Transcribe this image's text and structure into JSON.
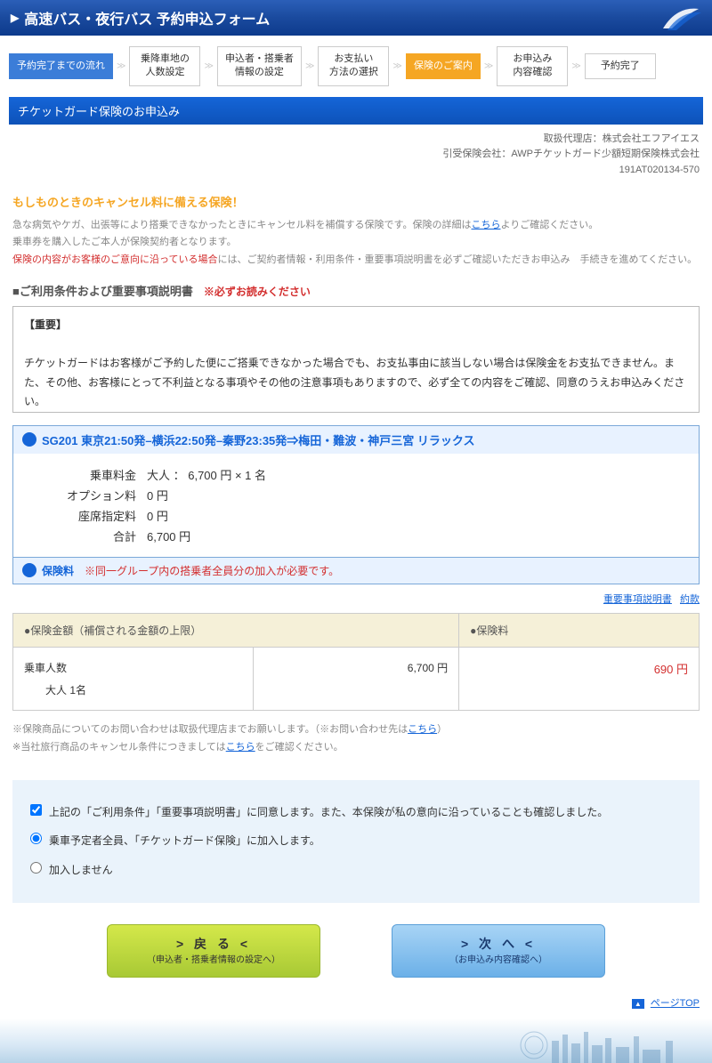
{
  "header": {
    "title": "高速バス・夜行バス 予約申込フォーム"
  },
  "steps": [
    {
      "label": "予約完了までの流れ",
      "type": "blue"
    },
    {
      "label": "乗降車地の\n人数設定",
      "type": "normal"
    },
    {
      "label": "申込者・搭乗者\n情報の設定",
      "type": "normal"
    },
    {
      "label": "お支払い\n方法の選択",
      "type": "normal"
    },
    {
      "label": "保険のご案内",
      "type": "orange"
    },
    {
      "label": "お申込み\n内容確認",
      "type": "normal"
    },
    {
      "label": "予約完了",
      "type": "normal"
    }
  ],
  "section_header": "チケットガード保険のお申込み",
  "right_info": {
    "line1": "取扱代理店：株式会社エフアイエス",
    "line2": "引受保険会社：AWPチケットガード少額短期保険株式会社",
    "line3": "191AT020134-570"
  },
  "orange_heading": "もしものときのキャンセル料に備える保険！",
  "desc": {
    "l1a": "急な病気やケガ、出張等により搭乗できなかったときにキャンセル料を補償する保険です。保険の詳細は",
    "l1link": "こちら",
    "l1b": "よりご確認ください。",
    "l2": "乗車券を購入したご本人が保険契約者となります。",
    "l3a": "保険の内容がお客様のご意向に沿っている場合",
    "l3b": "には、ご契約者情報・利用条件・重要事項説明書を必ずご確認いただきお申込み　手続きを進めてください。"
  },
  "terms_title": "■ご利用条件および重要事項説明書",
  "terms_note": "※必ずお読みください",
  "scroll": {
    "important": "【重要】",
    "body": "チケットガードはお客様がご予約した便にご搭乗できなかった場合でも、お支払事由に該当しない場合は保険金をお支払できません。また、その他、お客様にとって不利益となる事項やその他の注意事項もありますので、必ず全ての内容をご確認、同意のうえお申込みください。"
  },
  "trip": {
    "title": "SG201 東京21:50発–横浜22:50発–秦野23:35発⇒梅田・難波・神戸三宮 リラックス",
    "rows": [
      {
        "label": "乗車料金",
        "value": "大人 ： 6,700 円 × 1 名"
      },
      {
        "label": "オプション料",
        "value": "0 円"
      },
      {
        "label": "座席指定料",
        "value": "0 円"
      },
      {
        "label": "合計",
        "value": "6,700 円"
      }
    ]
  },
  "insurance_label": "保険料",
  "insurance_note": "※同一グループ内の搭乗者全員分の加入が必要です。",
  "links": {
    "l1": "重要事項説明書",
    "l2": "約款"
  },
  "table": {
    "th1": "●保険金額（補償される金額の上限）",
    "th2": "●保険料",
    "passengers_label": "乗車人数",
    "passengers_val": "大人 1名",
    "amount": "6,700 円",
    "premium": "690 円"
  },
  "footer_note": {
    "l1a": "※保険商品についてのお問い合わせは取扱代理店までお願いします。（※お問い合わせ先は",
    "l1link": "こちら",
    "l1b": "）",
    "l2a": "※当社旅行商品のキャンセル条件につきましては",
    "l2link": "こちら",
    "l2b": "をご確認ください。"
  },
  "agree": {
    "cb1": "上記の「ご利用条件」「重要事項説明書」に同意します。また、本保険が私の意向に沿っていることも確認しました。",
    "r1": "乗車予定者全員、「チケットガード保険」に加入します。",
    "r2": "加入しません"
  },
  "buttons": {
    "back_main": "> 戻 る <",
    "back_sub": "（申込者・搭乗者情報の設定へ）",
    "next_main": "> 次 へ <",
    "next_sub": "（お申込み内容確認へ）"
  },
  "pagetop": "ページTOP"
}
